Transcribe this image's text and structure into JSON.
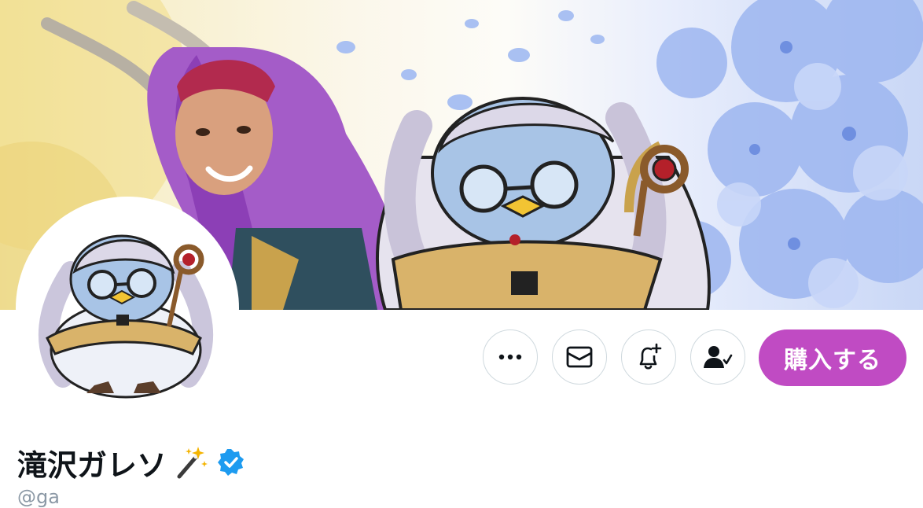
{
  "profile": {
    "display_name": "滝沢ガレソ",
    "handle": "@ga",
    "name_emoji_icon": "magic-wand-icon",
    "verified_icon": "verified-badge-icon"
  },
  "actions": {
    "more_icon": "more-icon",
    "message_icon": "mail-icon",
    "notify_icon": "bell-plus-icon",
    "following_icon": "person-check-icon",
    "buy_label": "購入する"
  },
  "colors": {
    "buy_button": "#c04bc3",
    "verified": "#1d9bf0",
    "outline": "#cfd9de"
  }
}
